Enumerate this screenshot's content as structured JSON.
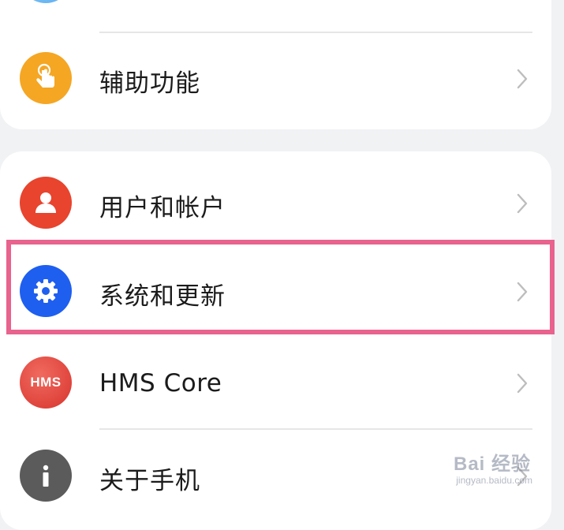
{
  "settings": {
    "accessibility": {
      "label": "辅助功能",
      "icon": "touch-hand-icon",
      "color": "#f5a623"
    },
    "users_accounts": {
      "label": "用户和帐户",
      "icon": "user-icon",
      "color": "#e8442e"
    },
    "system_updates": {
      "label": "系统和更新",
      "icon": "gear-icon",
      "color": "#1e5ff0"
    },
    "hms_core": {
      "label": "HMS Core",
      "icon_text": "HMS",
      "icon": "hms-logo-icon",
      "color": "#e3463f"
    },
    "about_phone": {
      "label": "关于手机",
      "icon": "info-icon",
      "color": "#5b5b5b"
    }
  },
  "watermark": {
    "brand": "Bai 经验",
    "url": "jingyan.baidu.com"
  },
  "highlight_color": "#e8638e"
}
